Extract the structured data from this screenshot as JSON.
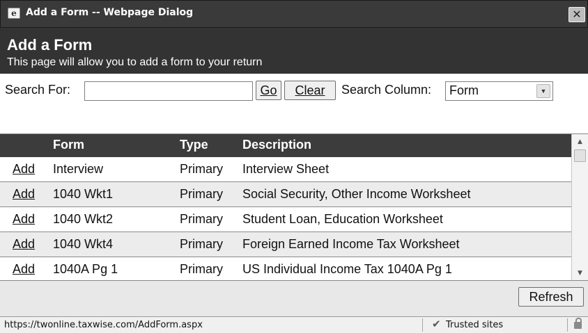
{
  "window": {
    "title": "Add a Form -- Webpage Dialog",
    "close_symbol": "✕"
  },
  "header": {
    "title": "Add a Form",
    "subtitle": "This page will allow you to add a form to your return"
  },
  "search": {
    "label": "Search For:",
    "value": "",
    "go_label": "Go",
    "clear_label": "Clear",
    "column_label": "Search Column:",
    "column_selected": "Form"
  },
  "grid": {
    "headers": {
      "add": "",
      "form": "Form",
      "type": "Type",
      "description": "Description"
    },
    "rows": [
      {
        "add": "Add",
        "form": "Interview",
        "type": "Primary",
        "description": "Interview Sheet"
      },
      {
        "add": "Add",
        "form": "1040 Wkt1",
        "type": "Primary",
        "description": "Social Security, Other Income Worksheet"
      },
      {
        "add": "Add",
        "form": "1040 Wkt2",
        "type": "Primary",
        "description": "Student Loan, Education Worksheet"
      },
      {
        "add": "Add",
        "form": "1040 Wkt4",
        "type": "Primary",
        "description": "Foreign Earned Income Tax Worksheet"
      },
      {
        "add": "Add",
        "form": "1040A Pg 1",
        "type": "Primary",
        "description": "US Individual Income Tax 1040A Pg 1"
      }
    ]
  },
  "footer": {
    "refresh_label": "Refresh"
  },
  "statusbar": {
    "url": "https://twonline.taxwise.com/AddForm.aspx",
    "zone": "Trusted sites"
  },
  "icons": {
    "app": "ie-page-icon",
    "close": "close-icon",
    "dropdown": "chevron-down-icon",
    "scroll_up": "scroll-up-icon",
    "scroll_down": "scroll-down-icon",
    "zone": "check-icon",
    "lock": "lock-icon"
  },
  "colors": {
    "titlebar": "#3a3a3a",
    "header_band": "#333333",
    "grid_header": "#3c3c3c",
    "alt_row": "#ececec",
    "footer": "#e8e8e8"
  }
}
